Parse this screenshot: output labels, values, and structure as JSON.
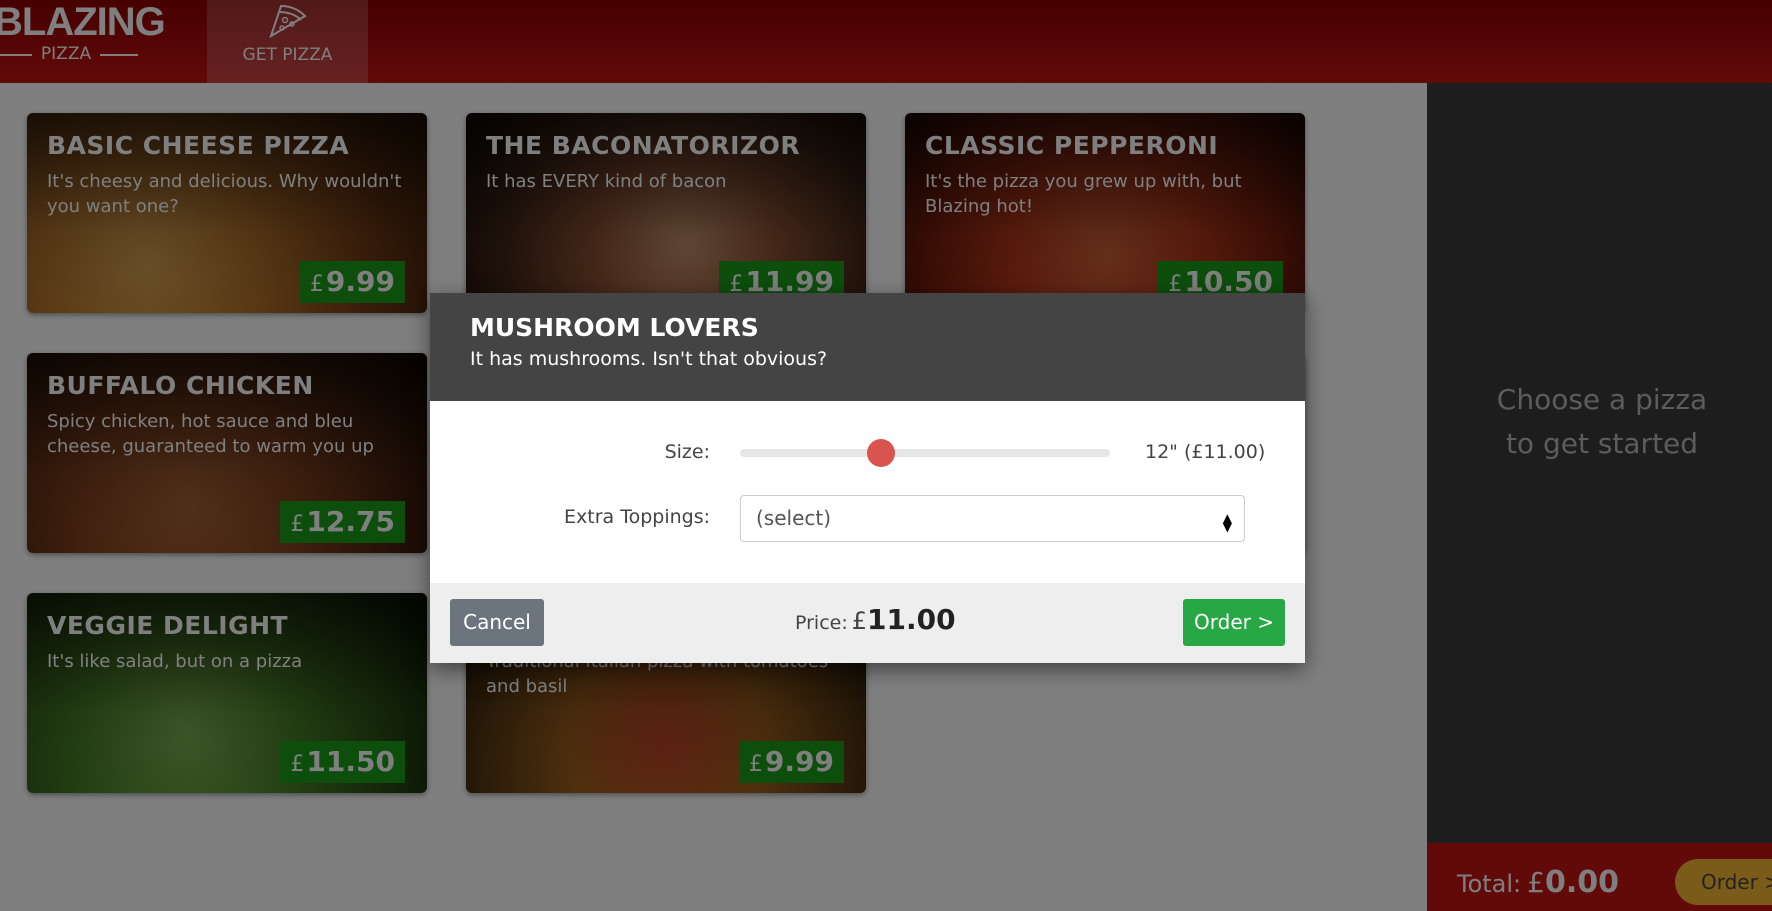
{
  "header": {
    "logo_main": "BLAZING",
    "logo_sub": "PIZZA",
    "nav_get_pizza": "GET PIZZA"
  },
  "currency_symbol": "£",
  "pizzas": [
    {
      "name": "BASIC CHEESE PIZZA",
      "description": "It's cheesy and delicious. Why wouldn't you want one?",
      "price": "9.99"
    },
    {
      "name": "THE BACONATORIZOR",
      "description": "It has EVERY kind of bacon",
      "price": "11.99"
    },
    {
      "name": "CLASSIC PEPPERONI",
      "description": "It's the pizza you grew up with, but Blazing hot!",
      "price": "10.50"
    },
    {
      "name": "BUFFALO CHICKEN",
      "description": "Spicy chicken, hot sauce and bleu cheese, guaranteed to warm you up",
      "price": "12.75"
    },
    {
      "name": "VEGGIE DELIGHT",
      "description": "It's like salad, but on a pizza",
      "price": "11.50"
    },
    {
      "name": "",
      "description": "Traditional Italian pizza with tomatoes and basil",
      "price": "9.99"
    }
  ],
  "sidebar": {
    "empty_text": "Choose a pizza to get started",
    "total_label": "Total:",
    "total_value": "0.00",
    "order_button": "Order >"
  },
  "dialog": {
    "title": "MUSHROOM LOVERS",
    "subtitle": "It has mushrooms. Isn't that obvious?",
    "size_label": "Size:",
    "size_value": "12\" (£11.00)",
    "size_slider_position": 0.38,
    "toppings_label": "Extra Toppings:",
    "toppings_value": "(select)",
    "cancel_button": "Cancel",
    "price_label": "Price:",
    "price_value": "11.00",
    "order_button": "Order >"
  },
  "colors": {
    "header_red": "#c41414",
    "price_green": "#1a9c1a",
    "order_green": "#28a745",
    "cancel_grey": "#6c757d",
    "slider_thumb": "#d9534f",
    "order_yellow": "#f7b733"
  }
}
